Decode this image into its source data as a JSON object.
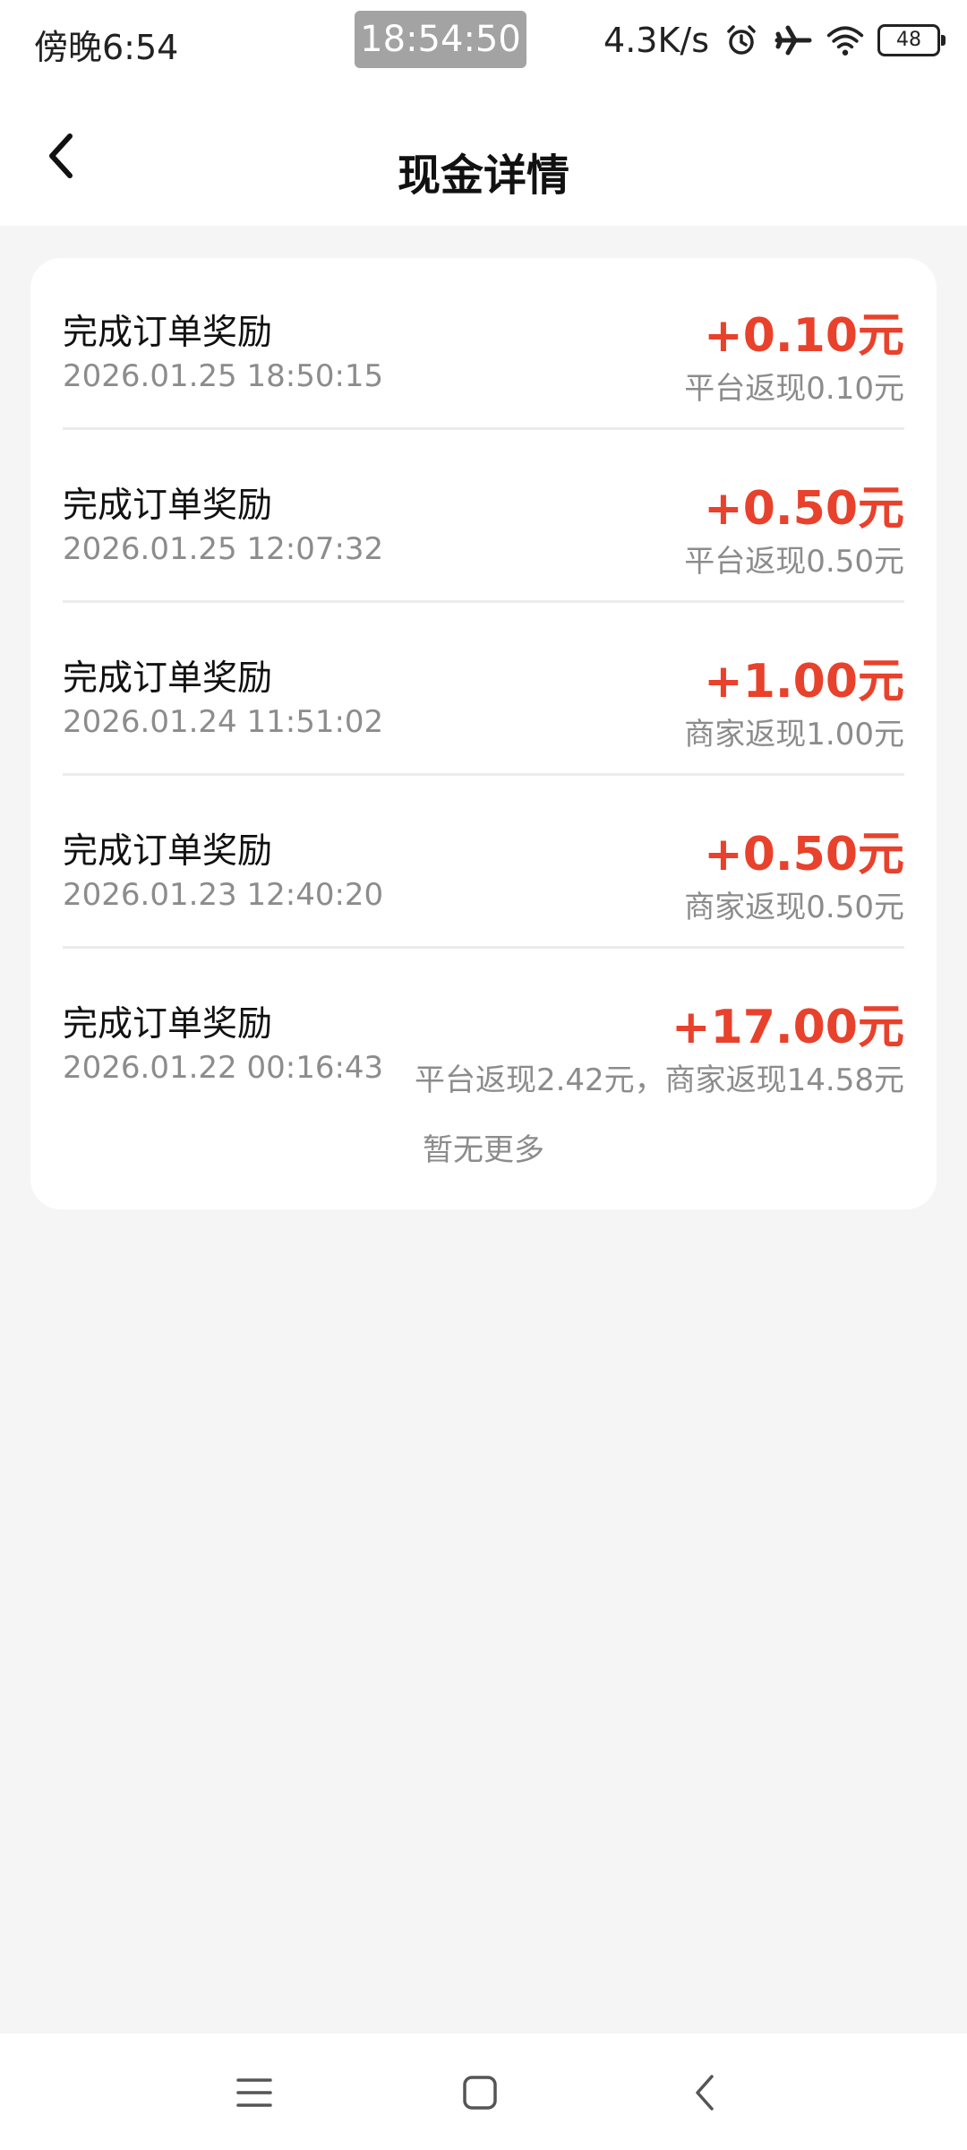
{
  "status_bar": {
    "left_time": "傍晚6:54",
    "center_time": "18:54:50",
    "network_speed": "4.3K/s",
    "battery_level": "48",
    "icons": [
      "alarm-icon",
      "airplane-icon",
      "wifi-icon",
      "battery-icon"
    ]
  },
  "header": {
    "title": "现金详情",
    "back_icon": "chevron-left-icon"
  },
  "records": [
    {
      "title": "完成订单奖励",
      "time": "2026.01.25 18:50:15",
      "amount": "+0.10元",
      "desc": "平台返现0.10元"
    },
    {
      "title": "完成订单奖励",
      "time": "2026.01.25 12:07:32",
      "amount": "+0.50元",
      "desc": "平台返现0.50元"
    },
    {
      "title": "完成订单奖励",
      "time": "2026.01.24 11:51:02",
      "amount": "+1.00元",
      "desc": "商家返现1.00元"
    },
    {
      "title": "完成订单奖励",
      "time": "2026.01.23 12:40:20",
      "amount": "+0.50元",
      "desc": "商家返现0.50元"
    },
    {
      "title": "完成订单奖励",
      "time": "2026.01.22 00:16:43",
      "amount": "+17.00元",
      "desc": "平台返现2.42元，商家返现14.58元"
    }
  ],
  "footer_text": "暂无更多",
  "colors": {
    "amount": "#e8412c",
    "background": "#f5f5f5",
    "card": "#ffffff",
    "secondary_text": "#8c8c8c"
  },
  "system_nav": [
    "menu-icon",
    "home-icon",
    "back-icon"
  ]
}
